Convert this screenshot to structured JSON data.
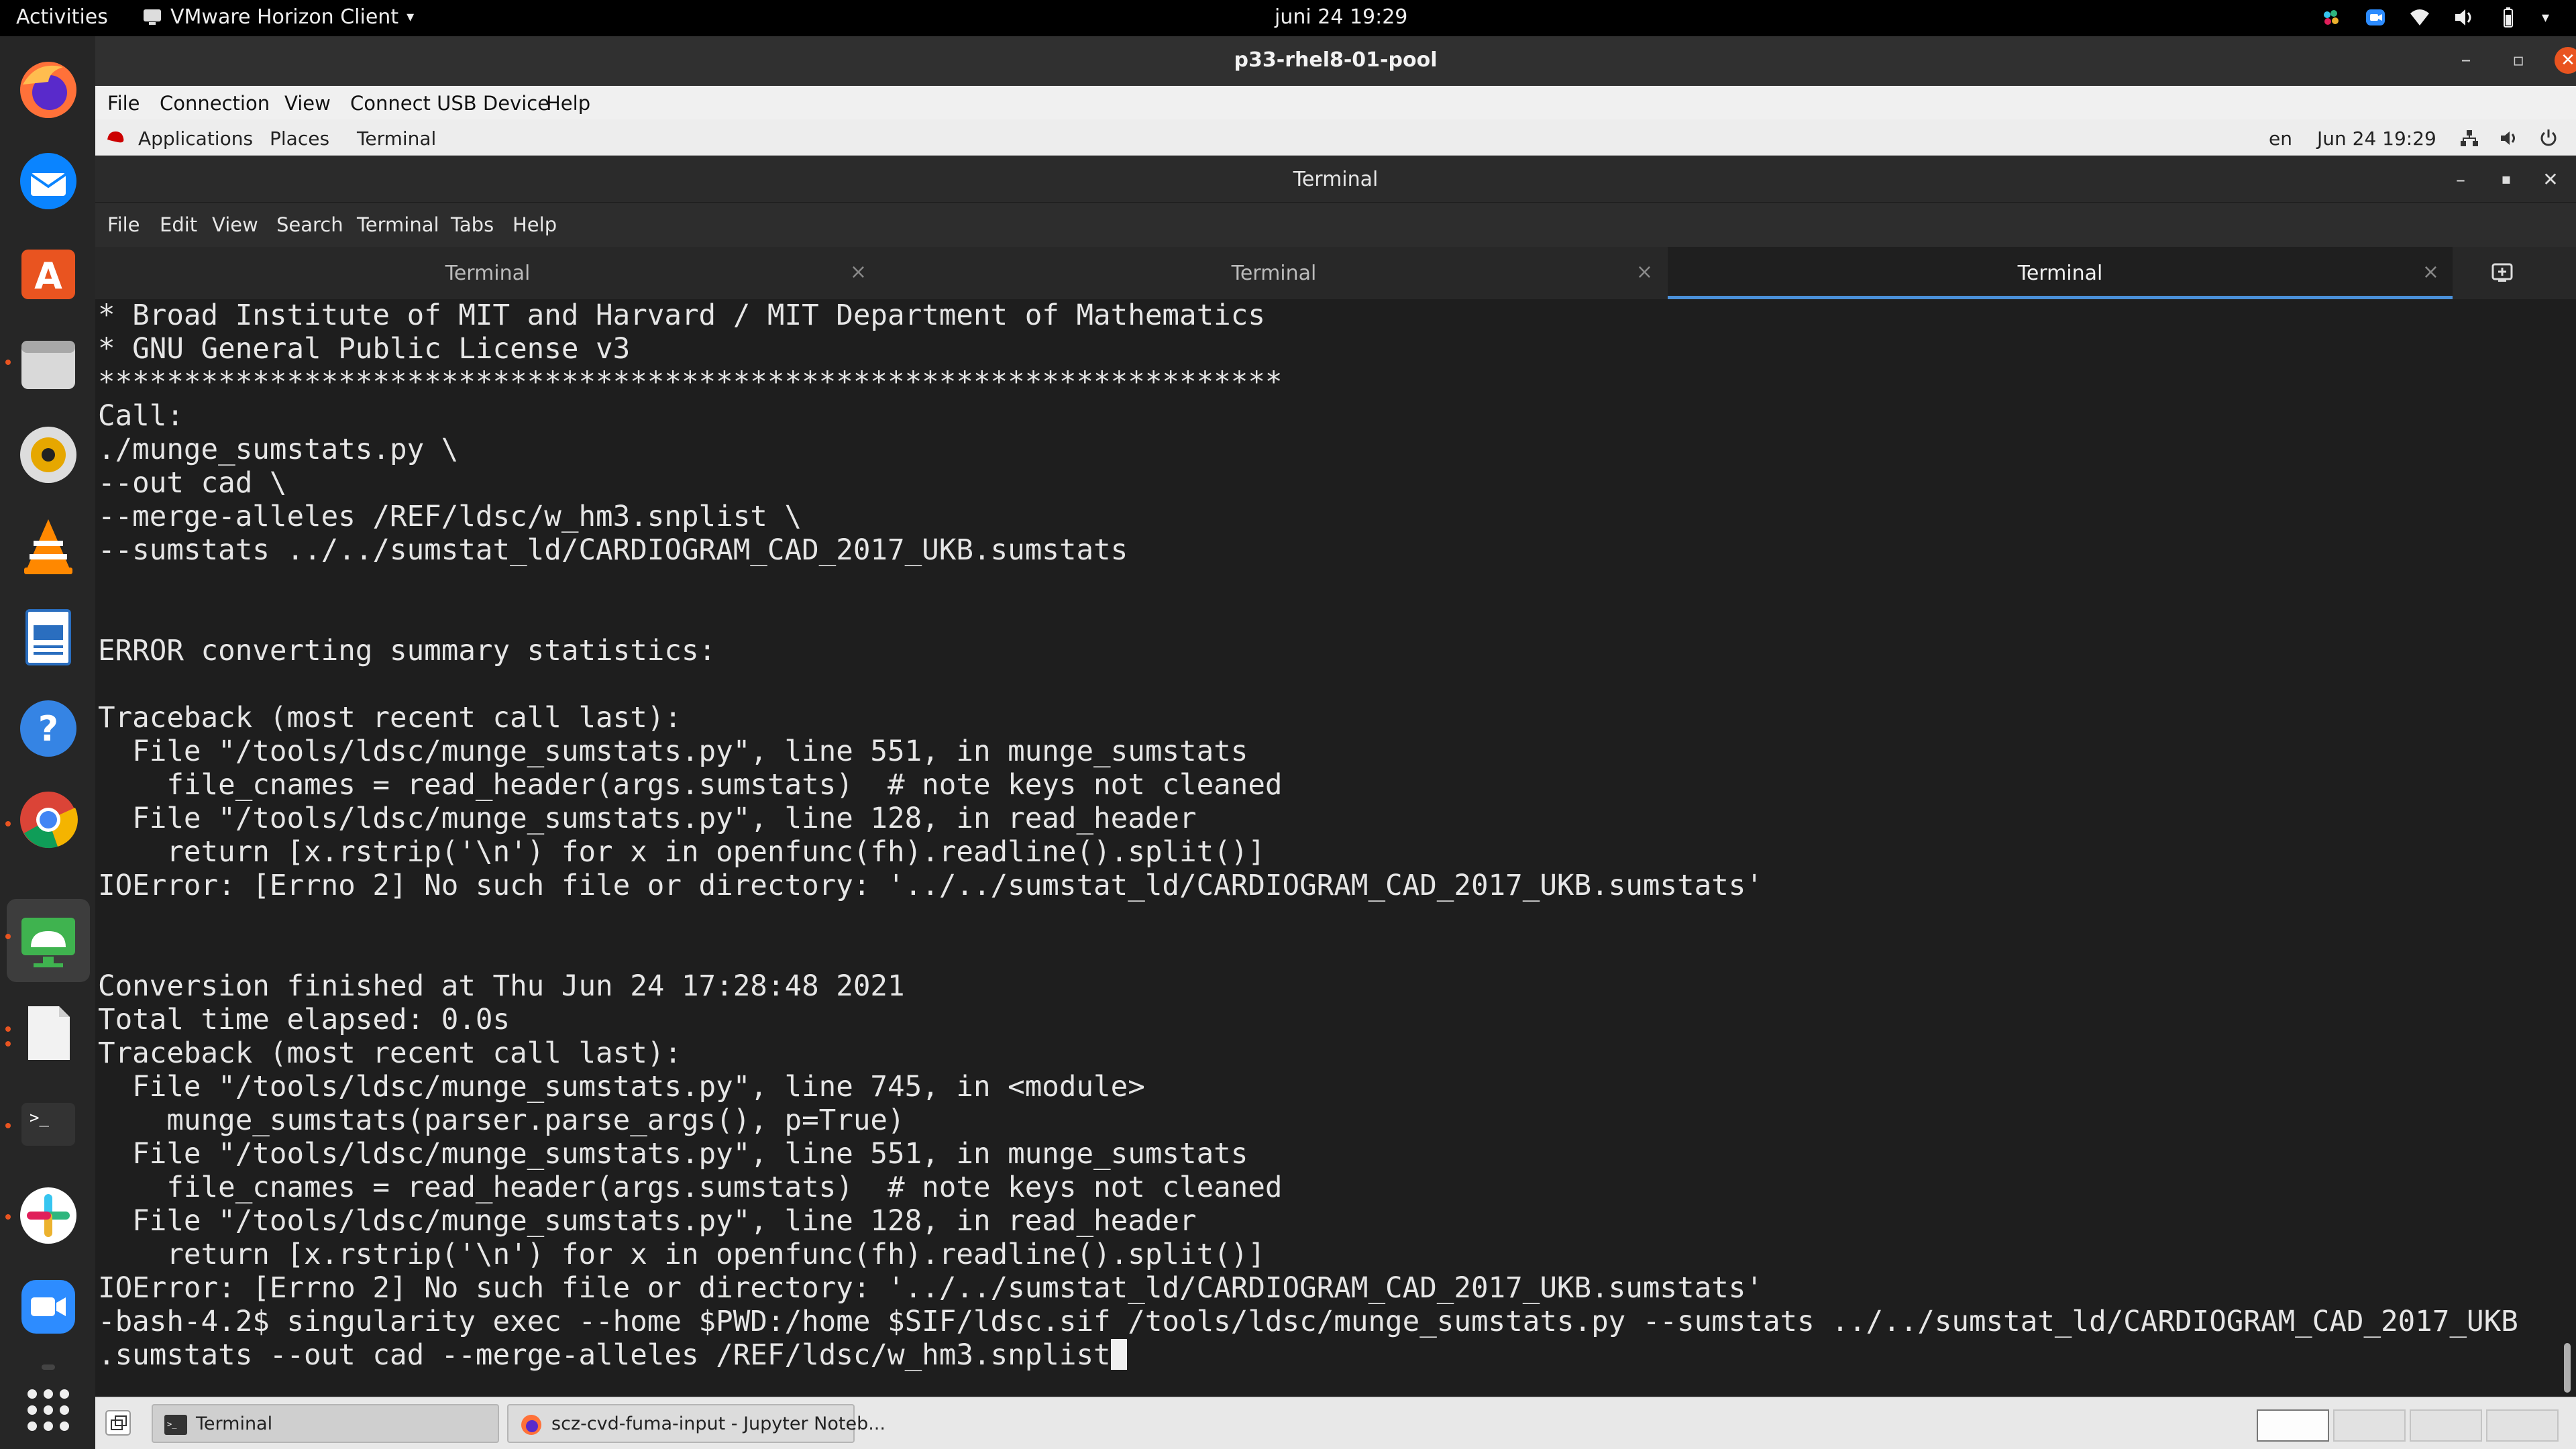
{
  "gnome_topbar": {
    "activities": "Activities",
    "app_name": "VMware Horizon Client",
    "clock": "juni 24  19:29"
  },
  "dock": {
    "apps": [
      "firefox-icon",
      "thunderbird-icon",
      "ubuntu-software-icon",
      "files-icon",
      "rhythmbox-icon",
      "vlc-icon",
      "libreoffice-writer-icon",
      "help-icon",
      "chrome-icon",
      "vmware-horizon-icon",
      "text-editor-icon",
      "terminal-icon",
      "slack-icon",
      "zoom-icon",
      "show-applications-icon"
    ]
  },
  "vmware": {
    "title": "p33-rhel8-01-pool",
    "menu": [
      "File",
      "Connection",
      "View",
      "Connect USB Device",
      "Help"
    ]
  },
  "remote_panel": {
    "applications": "Applications",
    "places": "Places",
    "terminal": "Terminal",
    "lang": "en",
    "clock": "Jun 24  19:29"
  },
  "terminal": {
    "title": "Terminal",
    "menu": [
      "File",
      "Edit",
      "View",
      "Search",
      "Terminal",
      "Tabs",
      "Help"
    ],
    "tabs": [
      "Terminal",
      "Terminal",
      "Terminal"
    ],
    "lines": [
      "* Broad Institute of MIT and Harvard / MIT Department of Mathematics",
      "* GNU General Public License v3",
      "*********************************************************************",
      "Call:",
      "./munge_sumstats.py \\",
      "--out cad \\",
      "--merge-alleles /REF/ldsc/w_hm3.snplist \\",
      "--sumstats ../../sumstat_ld/CARDIOGRAM_CAD_2017_UKB.sumstats",
      "",
      "",
      "ERROR converting summary statistics:",
      "",
      "Traceback (most recent call last):",
      "  File \"/tools/ldsc/munge_sumstats.py\", line 551, in munge_sumstats",
      "    file_cnames = read_header(args.sumstats)  # note keys not cleaned",
      "  File \"/tools/ldsc/munge_sumstats.py\", line 128, in read_header",
      "    return [x.rstrip('\\n') for x in openfunc(fh).readline().split()]",
      "IOError: [Errno 2] No such file or directory: '../../sumstat_ld/CARDIOGRAM_CAD_2017_UKB.sumstats'",
      "",
      "",
      "Conversion finished at Thu Jun 24 17:28:48 2021",
      "Total time elapsed: 0.0s",
      "Traceback (most recent call last):",
      "  File \"/tools/ldsc/munge_sumstats.py\", line 745, in <module>",
      "    munge_sumstats(parser.parse_args(), p=True)",
      "  File \"/tools/ldsc/munge_sumstats.py\", line 551, in munge_sumstats",
      "    file_cnames = read_header(args.sumstats)  # note keys not cleaned",
      "  File \"/tools/ldsc/munge_sumstats.py\", line 128, in read_header",
      "    return [x.rstrip('\\n') for x in openfunc(fh).readline().split()]",
      "IOError: [Errno 2] No such file or directory: '../../sumstat_ld/CARDIOGRAM_CAD_2017_UKB.sumstats'",
      "-bash-4.2$ singularity exec --home $PWD:/home $SIF/ldsc.sif /tools/ldsc/munge_sumstats.py --sumstats ../../sumstat_ld/CARDIOGRAM_CAD_2017_UKB"
    ],
    "last_line": ".sumstats --out cad --merge-alleles /REF/ldsc/w_hm3.snplist"
  },
  "window_list": {
    "items": [
      "Terminal",
      "scz-cvd-fuma-input - Jupyter Noteb..."
    ]
  }
}
